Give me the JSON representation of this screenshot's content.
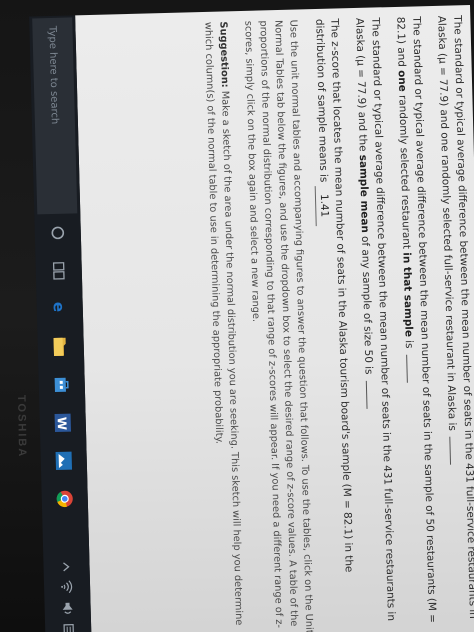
{
  "question": {
    "intro": "The standard or typical average difference between the mean number of seats in the 431 full-service restaurants in Alaska (μ = 77.9) and one randomly selected full-service restaurant in Alaska is",
    "sample_part1": "The standard or typical average difference between the mean number of seats in the sample of 50 restaurants (M = 82.1) and",
    "sample_bold1": "one",
    "sample_part2": "randomly selected restaurant",
    "sample_bold2": "in that sample",
    "sample_part3": "is",
    "mean_part1": "The standard or typical average difference between the mean number of seats in the 431 full-service restaurants in Alaska (μ = 77.9) and the",
    "mean_bold": "sample mean",
    "mean_part2": "of any sample of size 50 is",
    "zscore_prompt": "The z-score that locates the mean number of seats in the Alaska tourism board's sample (M = 82.1) in the distribution of sample means is",
    "zscore_value": "1.41",
    "instructions": "Use the unit normal tables and accompanying figures to answer the question that follows. To use the tables, click on the Unit Normal Tables tab below the figures, and use the dropdown box to select the desired range of z-score values. A table of the proportions of the normal distribution corresponding to that range of z-scores will appear. If you need a different range of z-scores, simply click on the box again and select a new range.",
    "suggestion_label": "Suggestion:",
    "suggestion_text": "Make a sketch of the area under the normal distribution you are seeking. This sketch will help you determine which column(s) of the normal table to use in determining the appropriate probability."
  },
  "taskbar": {
    "search_placeholder": "Type here to search",
    "brand": "TOSHIBA",
    "icons": [
      "windows-start-icon",
      "cortana-icon",
      "task-view-icon",
      "edge-icon",
      "file-explorer-icon",
      "store-icon",
      "word-icon",
      "photos-icon",
      "chrome-icon"
    ],
    "tray_icons": [
      "chevron-up-icon",
      "network-icon",
      "volume-icon",
      "notification-icon"
    ]
  },
  "colors": {
    "page_bg": "#e8e8e8",
    "taskbar_bg": "#181c22",
    "word_blue": "#2b579a",
    "edge_blue": "#1e73c8"
  }
}
